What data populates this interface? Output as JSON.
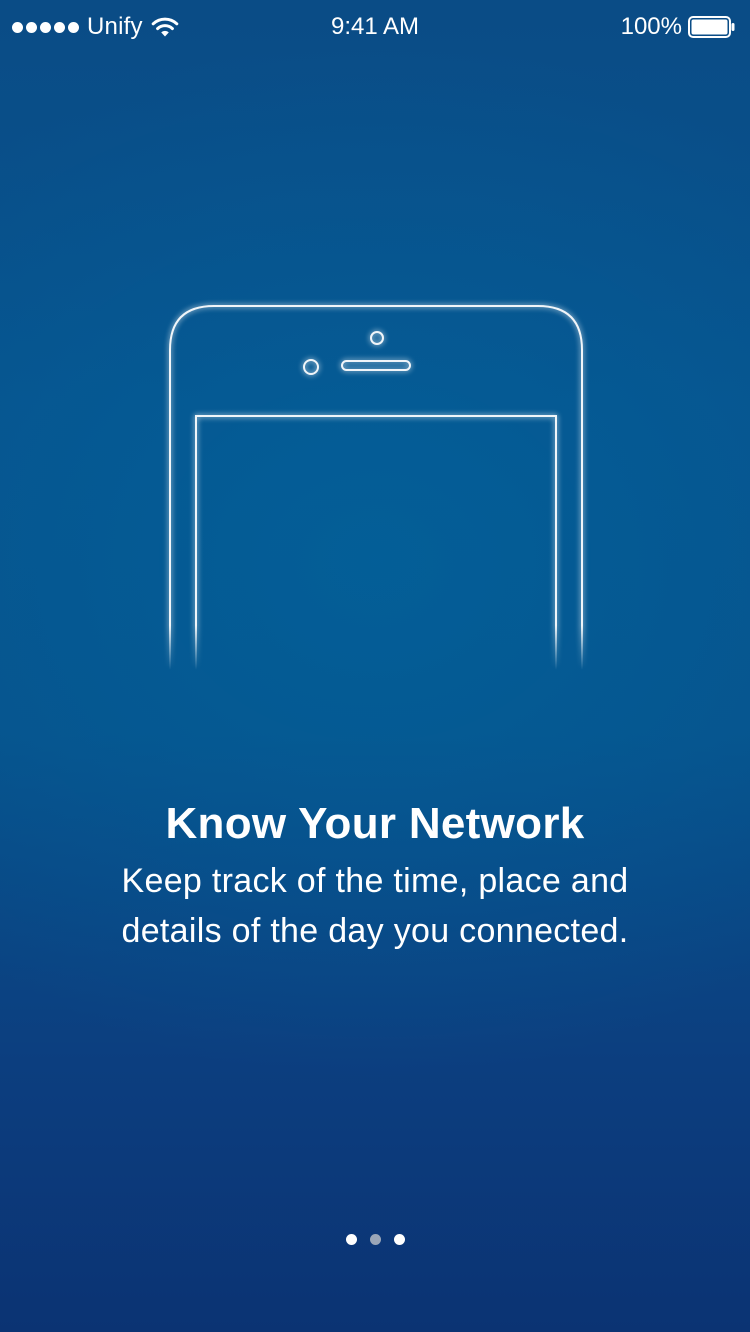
{
  "status_bar": {
    "signal_bars": 5,
    "carrier": "Unify",
    "time": "9:41 AM",
    "battery_percent": "100%",
    "battery_level": 1.0,
    "icons": [
      "signal-dots-icon",
      "wifi-icon",
      "battery-icon"
    ]
  },
  "onboarding": {
    "illustration": "phone-outline-icon",
    "headline": "Know Your Network",
    "description": "Keep track of the time, place and details of the day you connected."
  },
  "page_indicator": {
    "total": 3,
    "current": 2
  },
  "colors": {
    "background_top": "#0a4c86",
    "background_bottom": "#0b3373",
    "foreground": "#ffffff",
    "active_dot": "#9aa6b8"
  }
}
